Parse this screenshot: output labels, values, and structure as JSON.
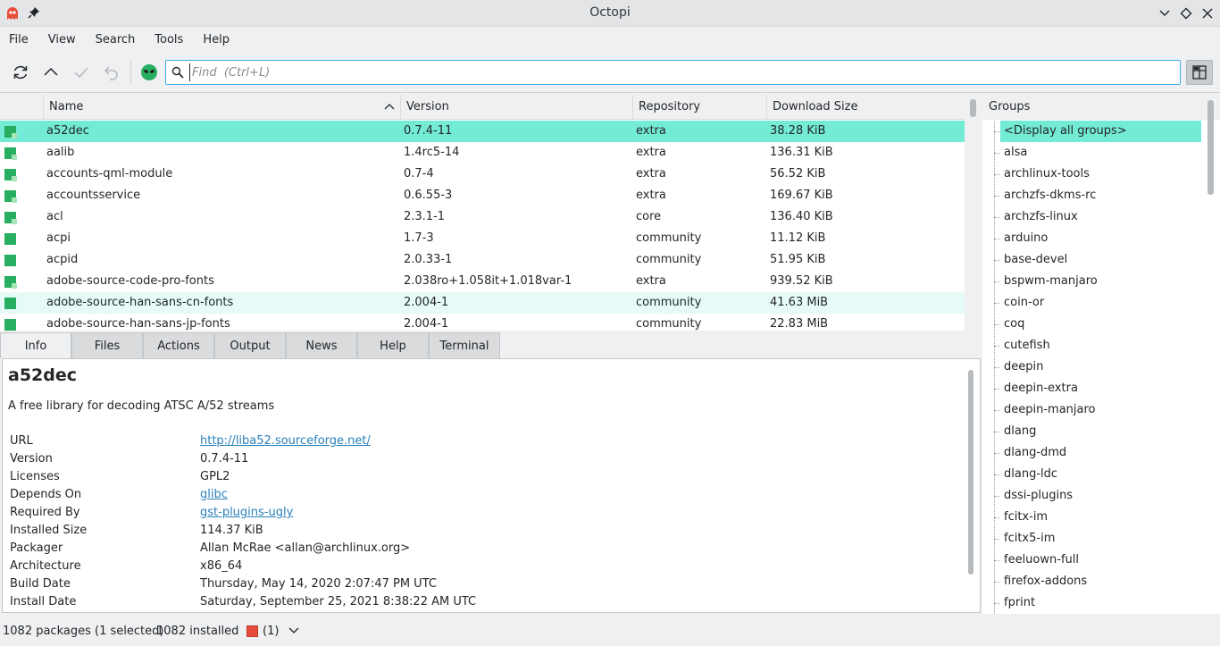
{
  "window": {
    "title": "Octopi"
  },
  "menu": [
    "File",
    "View",
    "Search",
    "Tools",
    "Help"
  ],
  "search": {
    "placeholder": "Find  (Ctrl+L)"
  },
  "table": {
    "columns": [
      "Name",
      "Version",
      "Repository",
      "Download Size"
    ],
    "rows": [
      {
        "name": "a52dec",
        "version": "0.7.4-11",
        "repo": "extra",
        "size": "38.28 KiB"
      },
      {
        "name": "aalib",
        "version": "1.4rc5-14",
        "repo": "extra",
        "size": "136.31 KiB"
      },
      {
        "name": "accounts-qml-module",
        "version": "0.7-4",
        "repo": "extra",
        "size": "56.52 KiB"
      },
      {
        "name": "accountsservice",
        "version": "0.6.55-3",
        "repo": "extra",
        "size": "169.67 KiB"
      },
      {
        "name": "acl",
        "version": "2.3.1-1",
        "repo": "core",
        "size": "136.40 KiB"
      },
      {
        "name": "acpi",
        "version": "1.7-3",
        "repo": "community",
        "size": "11.12 KiB"
      },
      {
        "name": "acpid",
        "version": "2.0.33-1",
        "repo": "community",
        "size": "51.95 KiB"
      },
      {
        "name": "adobe-source-code-pro-fonts",
        "version": "2.038ro+1.058it+1.018var-1",
        "repo": "extra",
        "size": "939.52 KiB"
      },
      {
        "name": "adobe-source-han-sans-cn-fonts",
        "version": "2.004-1",
        "repo": "community",
        "size": "41.63 MiB"
      },
      {
        "name": "adobe-source-han-sans-jp-fonts",
        "version": "2.004-1",
        "repo": "community",
        "size": "22.83 MiB"
      }
    ]
  },
  "tabs": [
    "Info",
    "Files",
    "Actions",
    "Output",
    "News",
    "Help",
    "Terminal"
  ],
  "info": {
    "name": "a52dec",
    "description": "A free library for decoding ATSC A/52 streams",
    "props": [
      {
        "label": "URL",
        "value": "http://liba52.sourceforge.net/"
      },
      {
        "label": "Version",
        "value": "0.7.4-11"
      },
      {
        "label": "Licenses",
        "value": "GPL2"
      },
      {
        "label": "Depends On",
        "value": "glibc"
      },
      {
        "label": "Required By",
        "value": "gst-plugins-ugly"
      },
      {
        "label": "Installed Size",
        "value": "114.37 KiB"
      },
      {
        "label": "Packager",
        "value": "Allan McRae <allan@archlinux.org>"
      },
      {
        "label": "Architecture",
        "value": "x86_64"
      },
      {
        "label": "Build Date",
        "value": "Thursday, May 14, 2020 2:07:47 PM UTC"
      },
      {
        "label": "Install Date",
        "value": "Saturday, September 25, 2021 8:38:22 AM UTC"
      }
    ]
  },
  "groups": {
    "header": "Groups",
    "items": [
      "<Display all groups>",
      "alsa",
      "archlinux-tools",
      "archzfs-dkms-rc",
      "archzfs-linux",
      "arduino",
      "base-devel",
      "bspwm-manjaro",
      "coin-or",
      "coq",
      "cutefish",
      "deepin",
      "deepin-extra",
      "deepin-manjaro",
      "dlang",
      "dlang-dmd",
      "dlang-ldc",
      "dssi-plugins",
      "fcitx-im",
      "fcitx5-im",
      "feeluown-full",
      "firefox-addons",
      "fprint"
    ]
  },
  "status": {
    "packages": "1082 packages (1 selected)",
    "installed": "1082 installed",
    "updates": "(1)"
  },
  "colors": {
    "selection": "#74ebd5",
    "accent": "#3daee9",
    "installed": "#27ae60",
    "link": "#2980b9"
  }
}
